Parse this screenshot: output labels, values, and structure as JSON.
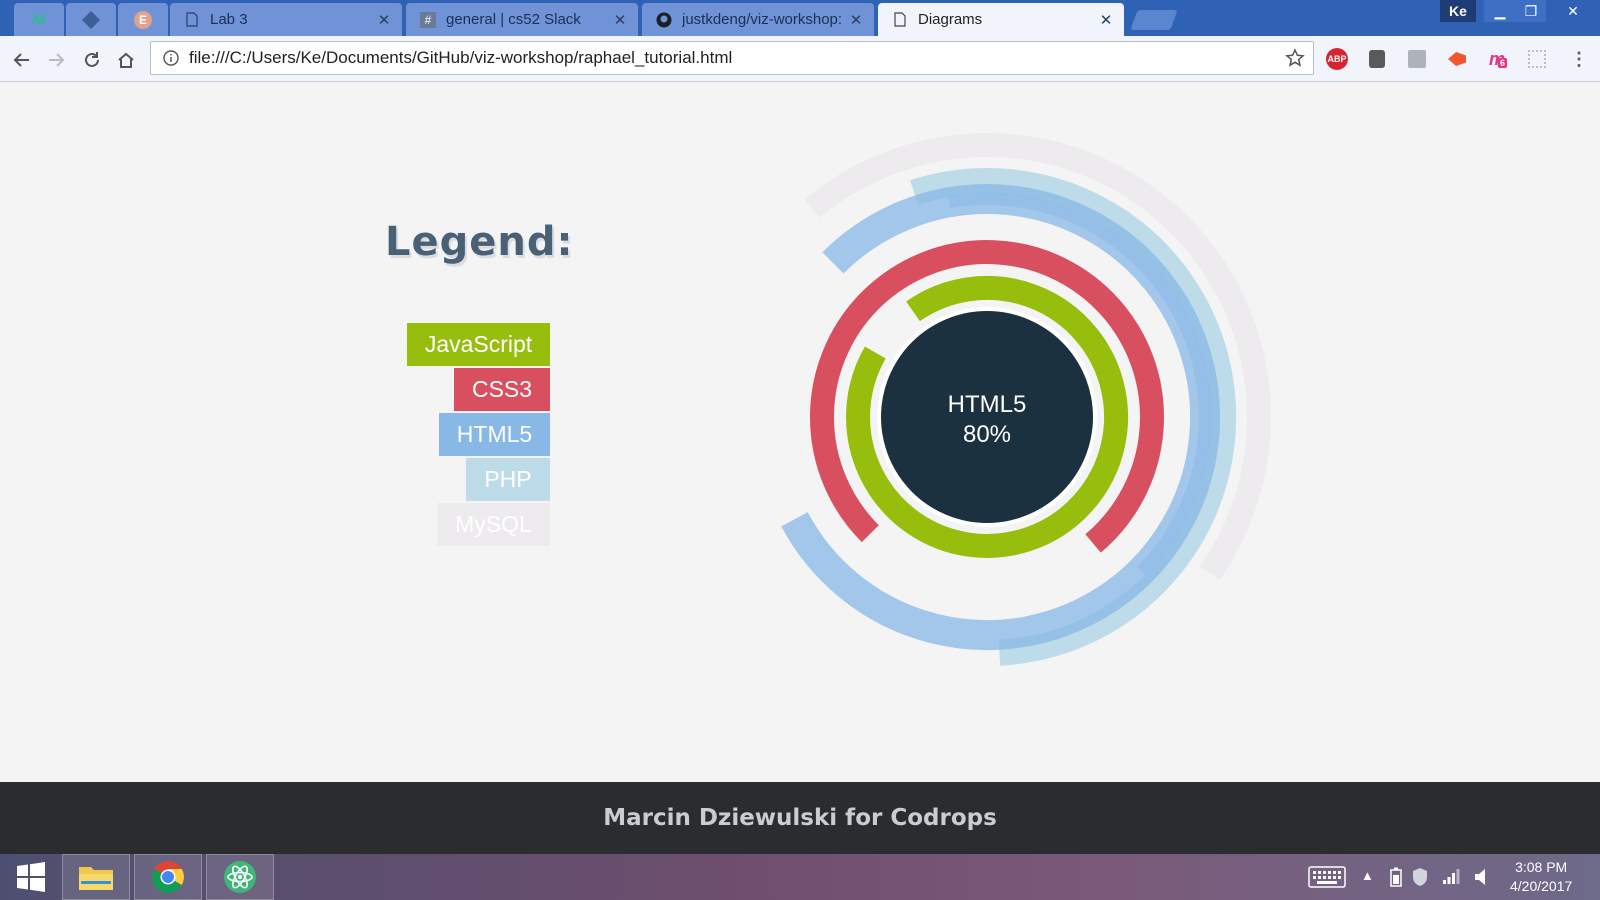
{
  "browser": {
    "tabs": [
      {
        "title": "Lab 3",
        "icon": "document-icon"
      },
      {
        "title": "general | cs52 Slack",
        "icon": "slack-icon"
      },
      {
        "title": "justkdeng/viz-workshop:",
        "icon": "github-icon"
      },
      {
        "title": "Diagrams",
        "icon": "document-icon",
        "active": true
      }
    ],
    "profile": "Ke",
    "url": "file:///C:/Users/Ke/Documents/GitHub/viz-workshop/raphael_tutorial.html",
    "extensions": [
      {
        "name": "adblock-icon",
        "label": "ABP"
      },
      {
        "name": "extension-icon-2",
        "label": ""
      },
      {
        "name": "extension-icon-3",
        "label": ""
      },
      {
        "name": "extension-icon-4",
        "label": ""
      },
      {
        "name": "extension-icon-5",
        "label": "6"
      },
      {
        "name": "extension-icon-6",
        "label": ""
      }
    ]
  },
  "page": {
    "legend_title": "Legend:",
    "center": {
      "label": "HTML5",
      "value": "80%"
    },
    "footer": "Marcin Dziewulski for Codrops"
  },
  "chart_data": {
    "type": "radial-bar",
    "center_label": "HTML5",
    "center_value": "80%",
    "series": [
      {
        "name": "JavaScript",
        "color": "#97be0d"
      },
      {
        "name": "CSS3",
        "color": "#d84f5f"
      },
      {
        "name": "HTML5",
        "color": "#88b8e6"
      },
      {
        "name": "PHP",
        "color": "#bedbe9"
      },
      {
        "name": "MySQL",
        "color": "#edebee"
      }
    ]
  },
  "taskbar": {
    "time": "3:08 PM",
    "date": "4/20/2017"
  }
}
